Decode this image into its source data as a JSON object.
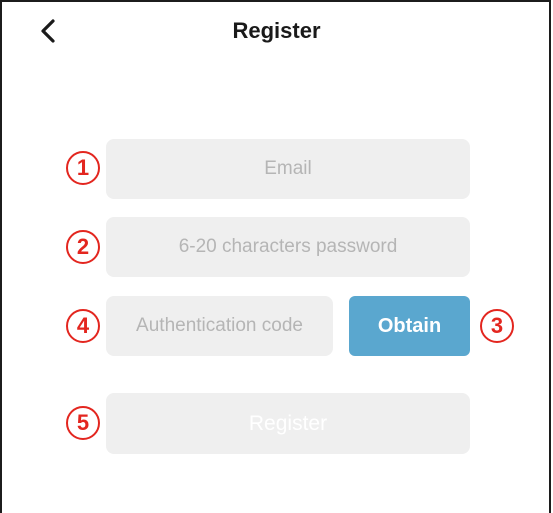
{
  "header": {
    "back_icon": "chevron-left-icon",
    "title": "Register"
  },
  "form": {
    "email_placeholder": "Email",
    "password_placeholder": "6-20 characters password",
    "auth_code_placeholder": "Authentication code",
    "obtain_label": "Obtain",
    "register_label": "Register"
  },
  "annotations": {
    "m1": "1",
    "m2": "2",
    "m3": "3",
    "m4": "4",
    "m5": "5"
  },
  "colors": {
    "accent": "#5aa7cf",
    "field_bg": "#efefef",
    "annotation": "#e3261f"
  }
}
